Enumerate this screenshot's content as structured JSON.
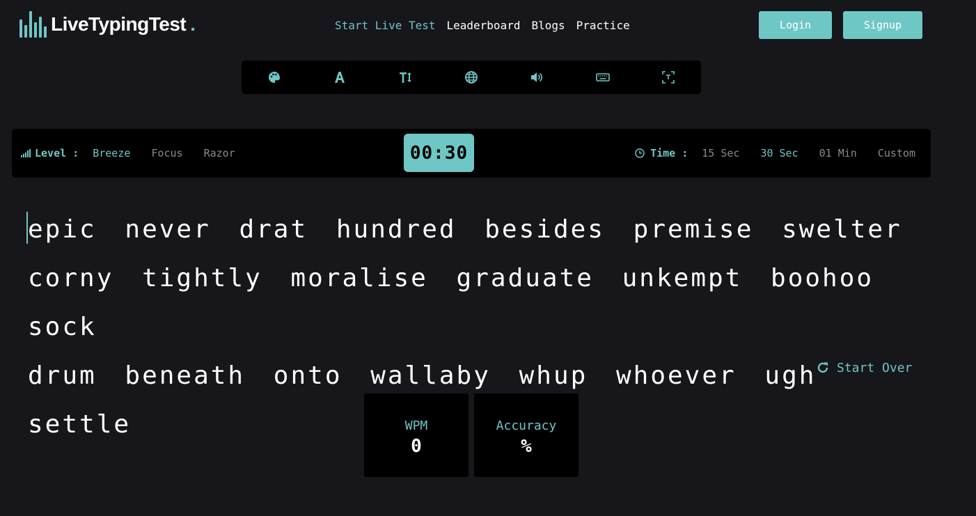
{
  "header": {
    "logo_text": "LiveTypingTest",
    "logo_dot": ".",
    "nav": [
      {
        "label": "Start Live Test",
        "active": true
      },
      {
        "label": "Leaderboard",
        "active": false
      },
      {
        "label": "Blogs",
        "active": false
      },
      {
        "label": "Practice",
        "active": false
      }
    ],
    "login_label": "Login",
    "signup_label": "Signup"
  },
  "toolbar": {
    "icons": [
      "palette-icon",
      "font-icon",
      "text-size-icon",
      "globe-icon",
      "sound-icon",
      "keyboard-icon",
      "fullscreen-icon"
    ]
  },
  "settings": {
    "level_label": "Level :",
    "levels": [
      {
        "label": "Breeze",
        "active": true
      },
      {
        "label": "Focus",
        "active": false
      },
      {
        "label": "Razor",
        "active": false
      }
    ],
    "timer": "00:30",
    "time_label": "Time :",
    "times": [
      {
        "label": "15 Sec",
        "active": false
      },
      {
        "label": "30 Sec",
        "active": true
      },
      {
        "label": "01 Min",
        "active": false
      },
      {
        "label": "Custom",
        "active": false
      }
    ]
  },
  "words": [
    [
      "epic",
      "never",
      "drat",
      "hundred",
      "besides",
      "premise",
      "swelter"
    ],
    [
      "corny",
      "tightly",
      "moralise",
      "graduate",
      "unkempt",
      "boohoo",
      "sock"
    ],
    [
      "drum",
      "beneath",
      "onto",
      "wallaby",
      "whup",
      "whoever",
      "ugh",
      "settle"
    ]
  ],
  "start_over_label": "Start Over",
  "stats": {
    "wpm_label": "WPM",
    "wpm_value": "0",
    "accuracy_label": "Accuracy",
    "accuracy_value": "%"
  },
  "colors": {
    "accent": "#6fc7c5",
    "background": "#16161b",
    "panel": "#000000"
  }
}
